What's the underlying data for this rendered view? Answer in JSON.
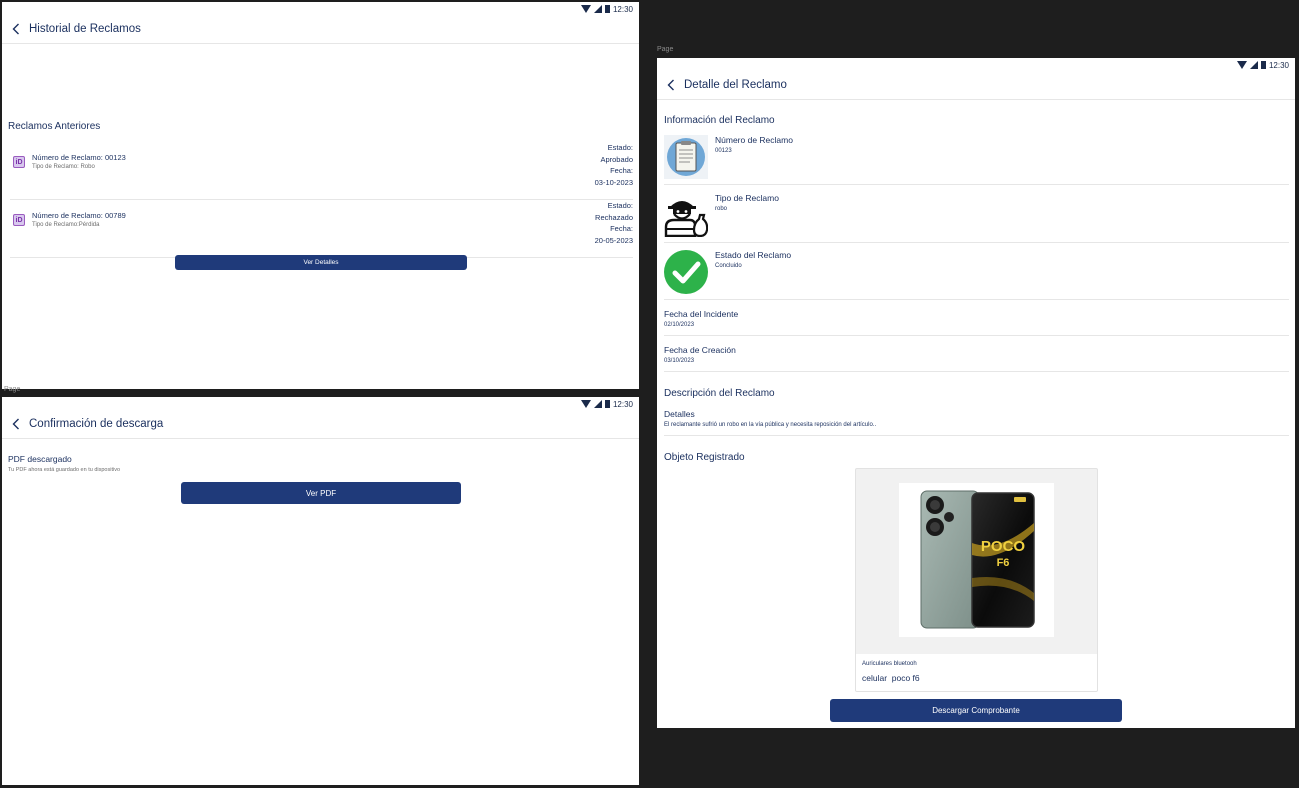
{
  "status": {
    "time": "12:30"
  },
  "canvas": {
    "frame_label": "Page",
    "frame_label_top": "Page"
  },
  "historial": {
    "title": "Historial de Reclamos",
    "section_title": "Reclamos Anteriores",
    "claims": [
      {
        "number": "Número de Reclamo: 00123",
        "type": "Tipo de Reclamo: Robo",
        "estado_label": "Estado:",
        "estado": "Aprobado",
        "fecha_label": "Fecha:",
        "fecha": "03-10-2023",
        "icon": "id-badge-icon"
      },
      {
        "number": "Número de Reclamo: 00789",
        "type": "Tipo de Reclamo:Pérdida",
        "estado_label": "Estado:",
        "estado": "Rechazado",
        "fecha_label": "Fecha:",
        "fecha": "20-05-2023",
        "icon": "id-badge-icon"
      }
    ],
    "details_button": "Ver Detalles"
  },
  "descarga": {
    "title": "Confirmación de descarga",
    "heading": "PDF descargado",
    "subtext": "Tu PDF ahora está guardado en tu dispositivo",
    "button": "Ver PDF"
  },
  "detalle": {
    "title": "Detalle del Reclamo",
    "info_section": "Información del Reclamo",
    "rows": [
      {
        "title": "Número de Reclamo",
        "value": "00123",
        "icon": "clipboard-icon"
      },
      {
        "title": "Tipo de Reclamo",
        "value": "robo",
        "icon": "thief-icon"
      },
      {
        "title": "Estado del Reclamo",
        "value": "Concluido",
        "icon": "check-circle-icon"
      }
    ],
    "fecha_incidente_label": "Fecha del Incidente",
    "fecha_incidente": "02/10/2023",
    "fecha_creacion_label": "Fecha de Creación",
    "fecha_creacion": "03/10/2023",
    "desc_section": "Descripción del Reclamo",
    "detalles_label": "Detalles",
    "detalles_text": "El reclamante sufrió un robo en la vía pública y necesita reposición del artículo..",
    "objeto_section": "Objeto Registrado",
    "object_caption": "Auriculares bluetooh",
    "object_name": "celular  poco f6",
    "phone_logo": "POCO",
    "phone_logo_sub": "F6",
    "download_button": "Descargar Comprobante"
  },
  "colors": {
    "navy": "#1a2f5e",
    "button": "#1f3a7a",
    "check": "#2db24a"
  }
}
